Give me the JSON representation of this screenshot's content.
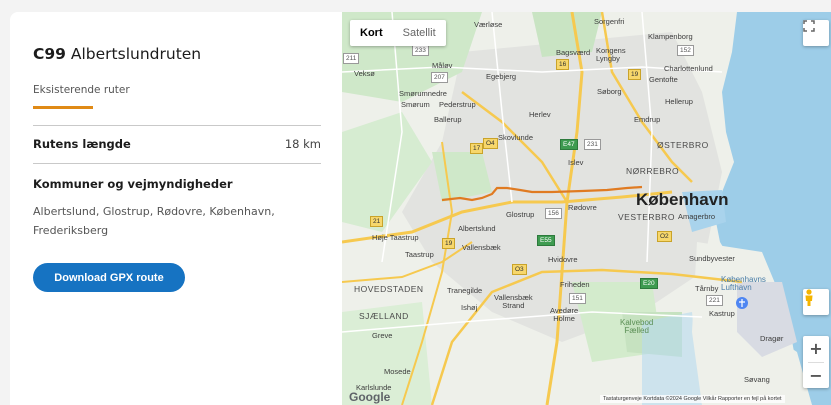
{
  "info": {
    "route_code": "C99",
    "route_name": "Albertslundruten",
    "category": "Eksisterende ruter",
    "length_label": "Rutens længde",
    "length_value": "18 km",
    "municipalities_heading": "Kommuner og vejmyndigheder",
    "municipalities": "Albertslund, Glostrup, Rødovre, København, Frederiksberg",
    "download_label": "Download GPX route"
  },
  "map": {
    "type_options": [
      "Kort",
      "Satellit"
    ],
    "selected_type": "Kort",
    "fullscreen_icon": "fullscreen-icon",
    "zoom_in": "+",
    "zoom_out": "−",
    "pegman_icon": "pegman-icon",
    "google_logo": "Google",
    "attribution": "Tastaturgenveje   Kortdata ©2024 Google   Vilkår   Rapporter en fejl på kortet",
    "route_color": "#e07b22",
    "labels": {
      "vaerlose": "Værløse",
      "sorgenfri": "Sorgenfri",
      "klampenborg": "Klampenborg",
      "bagsvaerd": "Bagsværd",
      "kongens_lyngby": "Kongens\nLyngby",
      "charlottenlund": "Charlottenlund",
      "veksoe": "Veksø",
      "malov": "Måløv",
      "egebjerg": "Egebjerg",
      "soborg": "Søborg",
      "gentofte": "Gentofte",
      "smorumnedre": "Smørumnedre",
      "smorum": "Smørum",
      "pederstrup": "Pederstrup",
      "herlev": "Herlev",
      "hellerup": "Hellerup",
      "ballerup": "Ballerup",
      "emdrup": "Emdrup",
      "skovlunde": "Skovlunde",
      "osterbro": "ØSTERBRO",
      "islev": "Islev",
      "norrebro": "NØRREBRO",
      "kobenhavn": "København",
      "vesterbro": "VESTERBRO",
      "amagerbro": "Amagerbro",
      "rodovre": "Rødovre",
      "glostrup": "Glostrup",
      "albertslund": "Albertslund",
      "hoje_taastrup": "Høje Taastrup",
      "vallensbaek": "Vallensbæk",
      "taastrup": "Taastrup",
      "hvidovre": "Hvidovre",
      "sundbyvester": "Sundbyvester",
      "kobenhavns_lufthavn": "Københavns\nLufthavn",
      "hovedstaden": "HOVEDSTADEN",
      "tranegilde": "Tranegilde",
      "friheden": "Friheden",
      "tarnby": "Tårnby",
      "vallensbaek_strand": "Vallensbæk\nStrand",
      "ishoj": "Ishøj",
      "avedore_holme": "Avedøre\nHolme",
      "kastrup": "Kastrup",
      "sjaelland": "SJÆLLAND",
      "kalvebod": "Kalvebod\nFælled",
      "greve": "Greve",
      "drager": "Dragør",
      "mosede": "Mosede",
      "sovang": "Søvang",
      "karlslunde": "Karlslunde"
    },
    "roads": [
      "233",
      "211",
      "207",
      "16",
      "19",
      "21",
      "17",
      "O4",
      "E47",
      "231",
      "156",
      "O2",
      "E20",
      "221",
      "151",
      "O3",
      "E55",
      "152",
      "19"
    ]
  }
}
